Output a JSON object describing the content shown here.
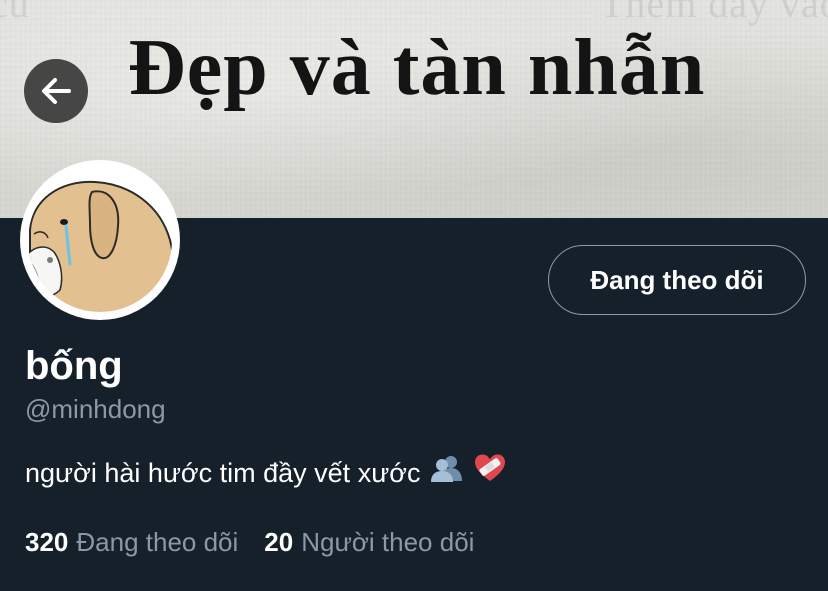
{
  "banner": {
    "title": "Đẹp và tàn nhẫn",
    "faint_text_left": "cu",
    "faint_text_right": "Thêm đầy vào cho cá"
  },
  "header": {
    "back_icon": "arrow-left-icon"
  },
  "profile": {
    "avatar_icon": "crying-dog-avatar",
    "follow_button_label": "Đang theo dõi",
    "name": "bống",
    "handle": "@minhdong",
    "bio": "người hài hước tim đầy vết xước",
    "bio_emojis": [
      "people-silhouette-emoji",
      "mending-heart-emoji"
    ]
  },
  "stats": {
    "following_count": "320",
    "following_label": "Đang theo dõi",
    "followers_count": "20",
    "followers_label": "Người theo dõi"
  },
  "colors": {
    "background": "#15202b",
    "secondary_text": "#8b98a5",
    "primary_text": "#ffffff",
    "button_border": "#8c9aa6"
  }
}
